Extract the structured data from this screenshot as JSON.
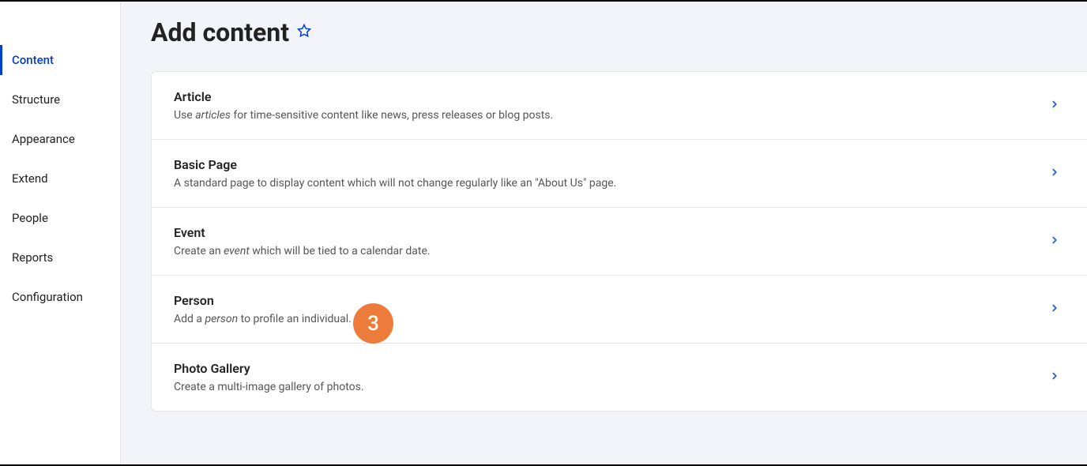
{
  "sidebar": {
    "items": [
      {
        "label": "Content",
        "active": true,
        "name": "sidebar-item-content"
      },
      {
        "label": "Structure",
        "active": false,
        "name": "sidebar-item-structure"
      },
      {
        "label": "Appearance",
        "active": false,
        "name": "sidebar-item-appearance"
      },
      {
        "label": "Extend",
        "active": false,
        "name": "sidebar-item-extend"
      },
      {
        "label": "People",
        "active": false,
        "name": "sidebar-item-people"
      },
      {
        "label": "Reports",
        "active": false,
        "name": "sidebar-item-reports"
      },
      {
        "label": "Configuration",
        "active": false,
        "name": "sidebar-item-configuration"
      }
    ]
  },
  "header": {
    "title": "Add content"
  },
  "content_types": [
    {
      "title": "Article",
      "desc_prefix": "Use ",
      "desc_em": "articles",
      "desc_suffix": " for time-sensitive content like news, press releases or blog posts.",
      "name": "content-type-article"
    },
    {
      "title": "Basic Page",
      "desc_prefix": "A standard page to display content which will not change regularly like an \"About Us\" page.",
      "desc_em": "",
      "desc_suffix": "",
      "name": "content-type-basic-page"
    },
    {
      "title": "Event",
      "desc_prefix": "Create an ",
      "desc_em": "event",
      "desc_suffix": " which will be tied to a calendar date.",
      "name": "content-type-event"
    },
    {
      "title": "Person",
      "desc_prefix": "Add a ",
      "desc_em": "person",
      "desc_suffix": " to profile an individual.",
      "name": "content-type-person"
    },
    {
      "title": "Photo Gallery",
      "desc_prefix": "Create a multi-image gallery of photos.",
      "desc_em": "",
      "desc_suffix": "",
      "name": "content-type-photo-gallery"
    }
  ],
  "annotation": {
    "number": "3"
  }
}
